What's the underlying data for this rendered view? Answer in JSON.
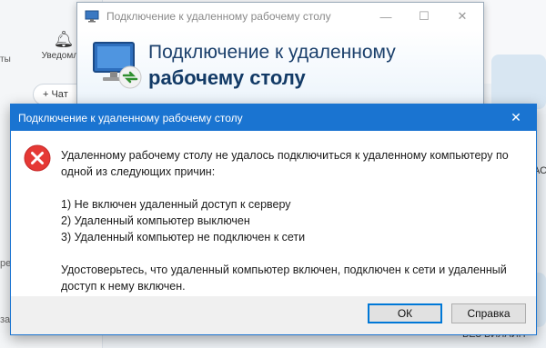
{
  "background": {
    "tab_fragment": "ты",
    "notifications_label": "Уведомл...",
    "chat_button": "+ Чат",
    "side_fragment_1": "ре",
    "side_fragment_2": "за",
    "right_fragment": "АС",
    "bottom_right_fragment": "БЕЗ БИЛАЙН"
  },
  "rdp_window": {
    "title": "Подключение к удаленному рабочему столу",
    "heading_line1": "Подключение к удаленному",
    "heading_line2": "рабочему столу",
    "minimize": "—",
    "maximize": "☐",
    "close": "✕"
  },
  "error_dialog": {
    "title": "Подключение к удаленному рабочему столу",
    "close": "✕",
    "message": "Удаленному рабочему столу не удалось подключиться к удаленному компьютеру по одной из следующих причин:",
    "reasons": [
      "1) Не включен удаленный доступ к серверу",
      "2) Удаленный компьютер выключен",
      "3) Удаленный компьютер не подключен к сети"
    ],
    "advice": "Удостоверьтесь, что удаленный компьютер включен, подключен к сети и удаленный доступ к нему включен.",
    "ok_label": "ОК",
    "help_label": "Справка"
  },
  "colors": {
    "accent": "#1a74d1",
    "error": "#e53935"
  },
  "icons": {
    "error": "error-circle-x-icon",
    "rdp": "remote-desktop-icon"
  }
}
